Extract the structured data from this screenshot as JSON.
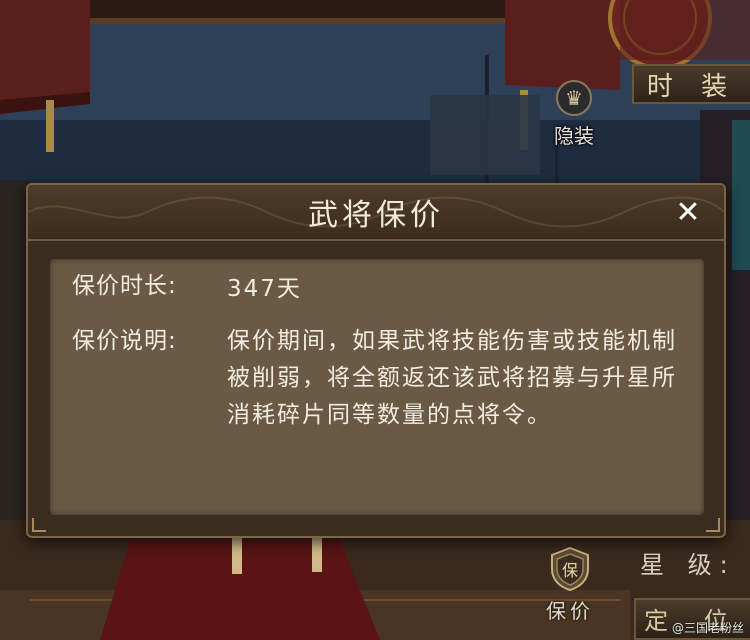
{
  "background": {
    "costume_tab": "时 装",
    "hide_outfit_label": "隐装",
    "protect_button_label": "保价",
    "star_level_label": "星 级:",
    "position_label": "定 位",
    "watermark": "@三国老粉丝"
  },
  "dialog": {
    "title": "武将保价",
    "close_label": "✕",
    "duration_key": "保价时长:",
    "duration_value": "347天",
    "description_key": "保价说明:",
    "description_value": "保价期间，如果武将技能伤害或技能机制被削弱，将全额返还该武将招募与升星所消耗碎片同等数量的点将令。"
  },
  "colors": {
    "dialog_bg": "#3a2c1f",
    "dialog_body_bg": "#6a5a45",
    "title_text": "#f3ead8",
    "border_gold": "#7c6546"
  },
  "icons": {
    "hide_outfit": "crown-icon",
    "protect": "shield-icon",
    "close": "close-icon"
  }
}
